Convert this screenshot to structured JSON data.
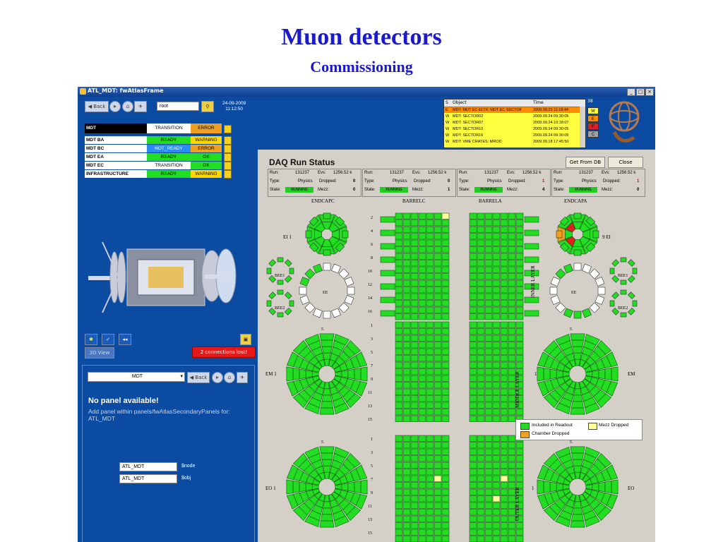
{
  "slide": {
    "title": "Muon detectors",
    "subtitle": "Commissioning"
  },
  "window": {
    "title": "ATL_MDT: fwAtlasFrame",
    "minimize": "_",
    "maximize": "□",
    "close": "×"
  },
  "nav": {
    "back_label": "Back",
    "search_value": "root",
    "date": "24-09-2009",
    "time": "11:12:50"
  },
  "status_table": {
    "header": {
      "name": "MDT",
      "state": "TRANSITION",
      "status": "ERROR"
    },
    "rows": [
      {
        "name": "MDT BA",
        "state": "READY",
        "status": "WARNING"
      },
      {
        "name": "MDT BC",
        "state": "NOT_READY",
        "status": "ERROR"
      },
      {
        "name": "MDT EA",
        "state": "READY",
        "status": "OK"
      },
      {
        "name": "MDT EC",
        "state": "TRANSITION",
        "status": "OK"
      },
      {
        "name": "INFRASTRUCTURE",
        "state": "READY",
        "status": "WARNING"
      }
    ]
  },
  "view": {
    "view3d_label": "3D View",
    "connections_label": "2 connections lost!"
  },
  "panel_area": {
    "select_value": "MDT",
    "back_label": "Back",
    "no_panel_title": "No panel available!",
    "no_panel_text": "Add panel within panels/fwAtlasSecondaryPanels for: ATL_MDT",
    "node_value": "ATL_MDT",
    "node_label": "$node",
    "obj_value": "ATL_MDT",
    "obj_label": "$obj"
  },
  "alarms": {
    "col_s": "S",
    "col_object": "Object",
    "col_time": "Time",
    "rows": [
      {
        "s": "E",
        "object": "MDT: MDT EC ELTX: MDT EC SECTOF",
        "time": "2009.09.23 11:18:44",
        "color": "#ff8c00"
      },
      {
        "s": "W",
        "object": "MDT: SECTOR02",
        "time": "2009.09.24 09:30:05",
        "color": "#ffff40"
      },
      {
        "s": "W",
        "object": "MDT: SECTOR07",
        "time": "2009.09.24 10:18:07",
        "color": "#ffff40"
      },
      {
        "s": "W",
        "object": "MDT: SECTOR10",
        "time": "2009.09.24 09:30:05",
        "color": "#ffff40"
      },
      {
        "s": "W",
        "object": "MDT: SECTOR16",
        "time": "2009.09.24 09:30:05",
        "color": "#ffff40"
      },
      {
        "s": "W",
        "object": "MDT: VME CRATES: MROD",
        "time": "2009.09.18 17:45:50",
        "color": "#ffff40"
      }
    ],
    "count": "38",
    "severity": [
      "W",
      "E",
      "F",
      "C"
    ],
    "severity_colors": [
      "#ffff40",
      "#ff8c00",
      "#e02020",
      "#a0a0a0"
    ]
  },
  "atlas_logo": "ATLAS",
  "daq": {
    "title": "DAQ Run Status",
    "get_from_db": "Get From DB",
    "close": "Close",
    "panels": [
      {
        "run": "131237",
        "evs": "1256.52 k",
        "type": "Physics",
        "dropped": "0",
        "state": "RUNNING",
        "mezz": "0"
      },
      {
        "run": "131237",
        "evs": "1256.52 k",
        "type": "Physics",
        "dropped": "0",
        "state": "RUNNING",
        "mezz": "1"
      },
      {
        "run": "131237",
        "evs": "1256.52 k",
        "type": "Physics",
        "dropped": "1",
        "state": "RUNNING",
        "mezz": "4"
      },
      {
        "run": "131237",
        "evs": "1256.52 k",
        "type": "Physics",
        "dropped": "1",
        "state": "RUNNING",
        "mezz": "0"
      }
    ],
    "labels": {
      "run": "Run:",
      "evs": "Evs:",
      "type": "Type:",
      "dropped": "Dropped:",
      "state": "State:",
      "mezz": "Mezz:",
      "endcap_c": "ENDCAPC",
      "barrel_c": "BARRELC",
      "barrel_a": "BARRELA",
      "endcap_a": "ENDCAPA",
      "ei": "EI",
      "bee1": "BEE1",
      "bee2": "BEE2",
      "ee": "EE",
      "em": "EM",
      "eo": "EO",
      "inner_layer": "INNER LAYER",
      "middle_layer": "MIDDLE LAYER",
      "outer_layer": "OUTER LAYER",
      "one": "1",
      "five": "5",
      "nine": "9"
    },
    "inner_rows": [
      "2",
      "4",
      "6",
      "8",
      "10",
      "12",
      "14",
      "16"
    ],
    "middle_rows": [
      "1",
      "3",
      "5",
      "7",
      "9",
      "11",
      "13",
      "15"
    ],
    "outer_rows": [
      "1",
      "3",
      "5",
      "7",
      "9",
      "11",
      "13",
      "15"
    ],
    "legend": {
      "included": "Included in Readout",
      "mezz": "Mezz Dropped",
      "chamber": "Chamber Dropped"
    },
    "colors": {
      "included": "#22dd22",
      "mezz": "#ffff99",
      "chamber": "#f0a020",
      "off": "#ffffff"
    }
  }
}
